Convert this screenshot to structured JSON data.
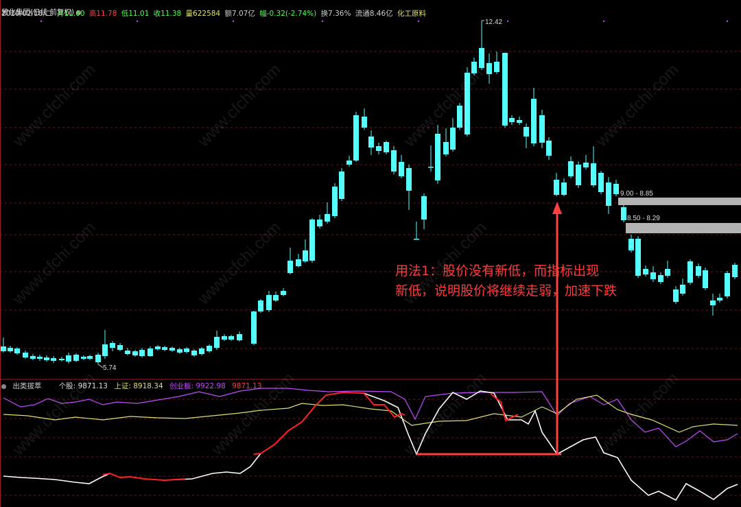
{
  "header": {
    "title": "雅化集团(日线 前复权)",
    "date": "2020/02/18/二",
    "open": "开11.60",
    "high": "高11.78",
    "low": "低11.01",
    "close": "收11.38",
    "volume": "量622584",
    "amount": "额7.07亿",
    "change": "幅-0.32(-2.74%)",
    "turnover": "换7.36%",
    "float": "流通8.46亿",
    "sector": "化工原料"
  },
  "price_labels": {
    "high": "12.42",
    "low": "5.74"
  },
  "zones": [
    {
      "label": "9.00 - 8.85"
    },
    {
      "label": "8.50 - 8.29"
    }
  ],
  "callout": {
    "line1": "用法1：股价没有新低，而指标出现",
    "line2": "新低，说明股价将继续走弱，加速下跌"
  },
  "indicator": {
    "name": "出类拔萃",
    "stock": "个股: 9871.13",
    "sh": "上证: 8918.34",
    "cyb": "创业板: 9922.98",
    "val": "9871.13"
  },
  "watermark": "www.cfchi.com",
  "colors": {
    "up": "#ff3c3c",
    "down": "#54ffff",
    "purple": "#c24cff",
    "yellow": "#e0e070",
    "white": "#ffffff",
    "red": "#ff2020",
    "grid": "#7a1616"
  }
}
